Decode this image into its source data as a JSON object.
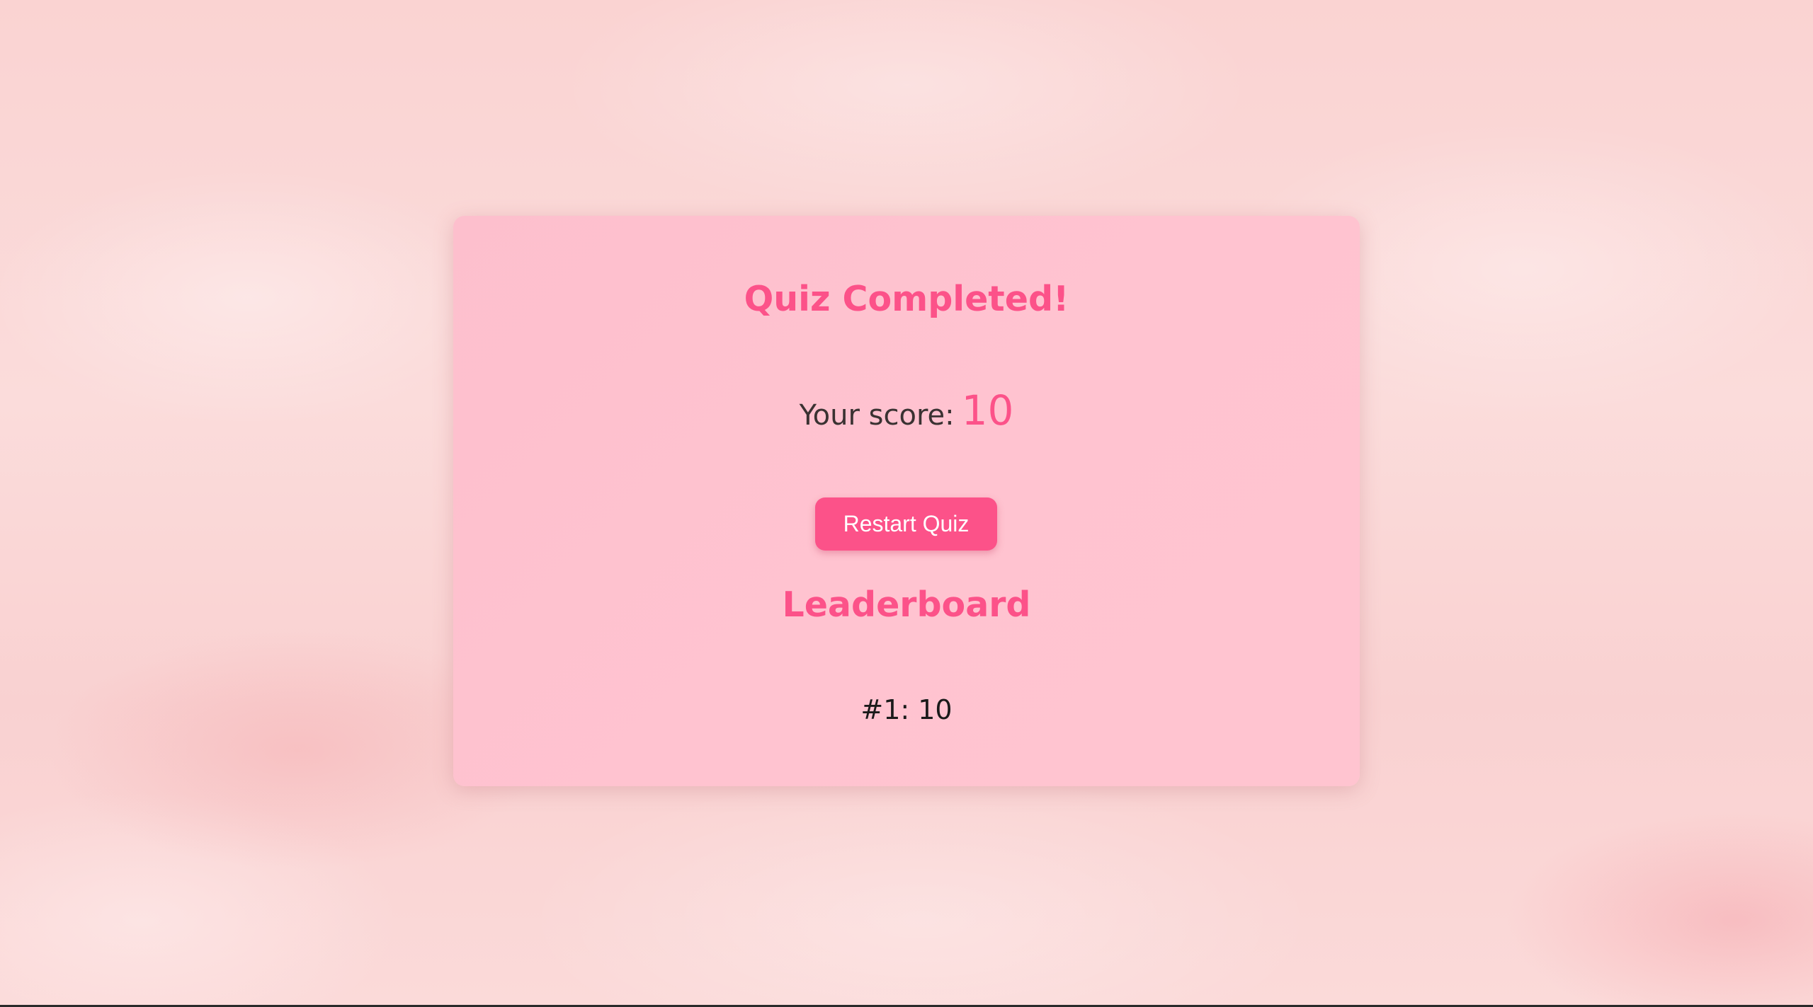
{
  "quiz": {
    "title": "Quiz Completed!",
    "score_label": "Your score:",
    "score_value": "10",
    "restart_label": "Restart Quiz"
  },
  "leaderboard": {
    "title": "Leaderboard",
    "entries": [
      {
        "text": "#1: 10"
      }
    ]
  },
  "colors": {
    "accent": "#fc5289",
    "card_background": "#ffc3d0",
    "page_background": "#fbd3d4",
    "text_dark": "#3a3232"
  }
}
